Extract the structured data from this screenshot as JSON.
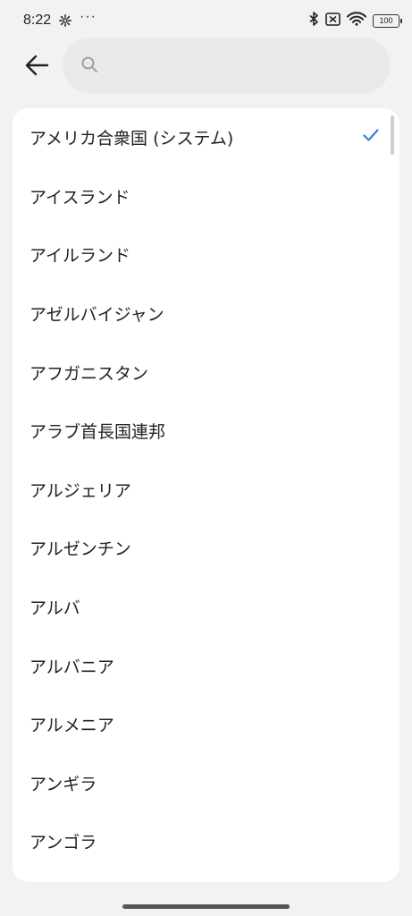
{
  "status": {
    "time": "8:22",
    "more": "···",
    "battery": "100",
    "icons": [
      "gear-icon",
      "bluetooth-icon",
      "no-sim-icon",
      "wifi-icon",
      "battery-icon"
    ]
  },
  "search": {
    "placeholder": "",
    "value": ""
  },
  "countries": [
    {
      "label": "アメリカ合衆国 (システム)",
      "selected": true
    },
    {
      "label": "アイスランド"
    },
    {
      "label": "アイルランド"
    },
    {
      "label": "アゼルバイジャン"
    },
    {
      "label": "アフガニスタン"
    },
    {
      "label": "アラブ首長国連邦"
    },
    {
      "label": "アルジェリア"
    },
    {
      "label": "アルゼンチン"
    },
    {
      "label": "アルバ"
    },
    {
      "label": "アルバニア"
    },
    {
      "label": "アルメニア"
    },
    {
      "label": "アンギラ"
    },
    {
      "label": "アンゴラ"
    }
  ],
  "colors": {
    "accent": "#3a7be0",
    "background": "#f2f2f2",
    "card": "#ffffff",
    "search_bg": "#e9e9e9"
  }
}
